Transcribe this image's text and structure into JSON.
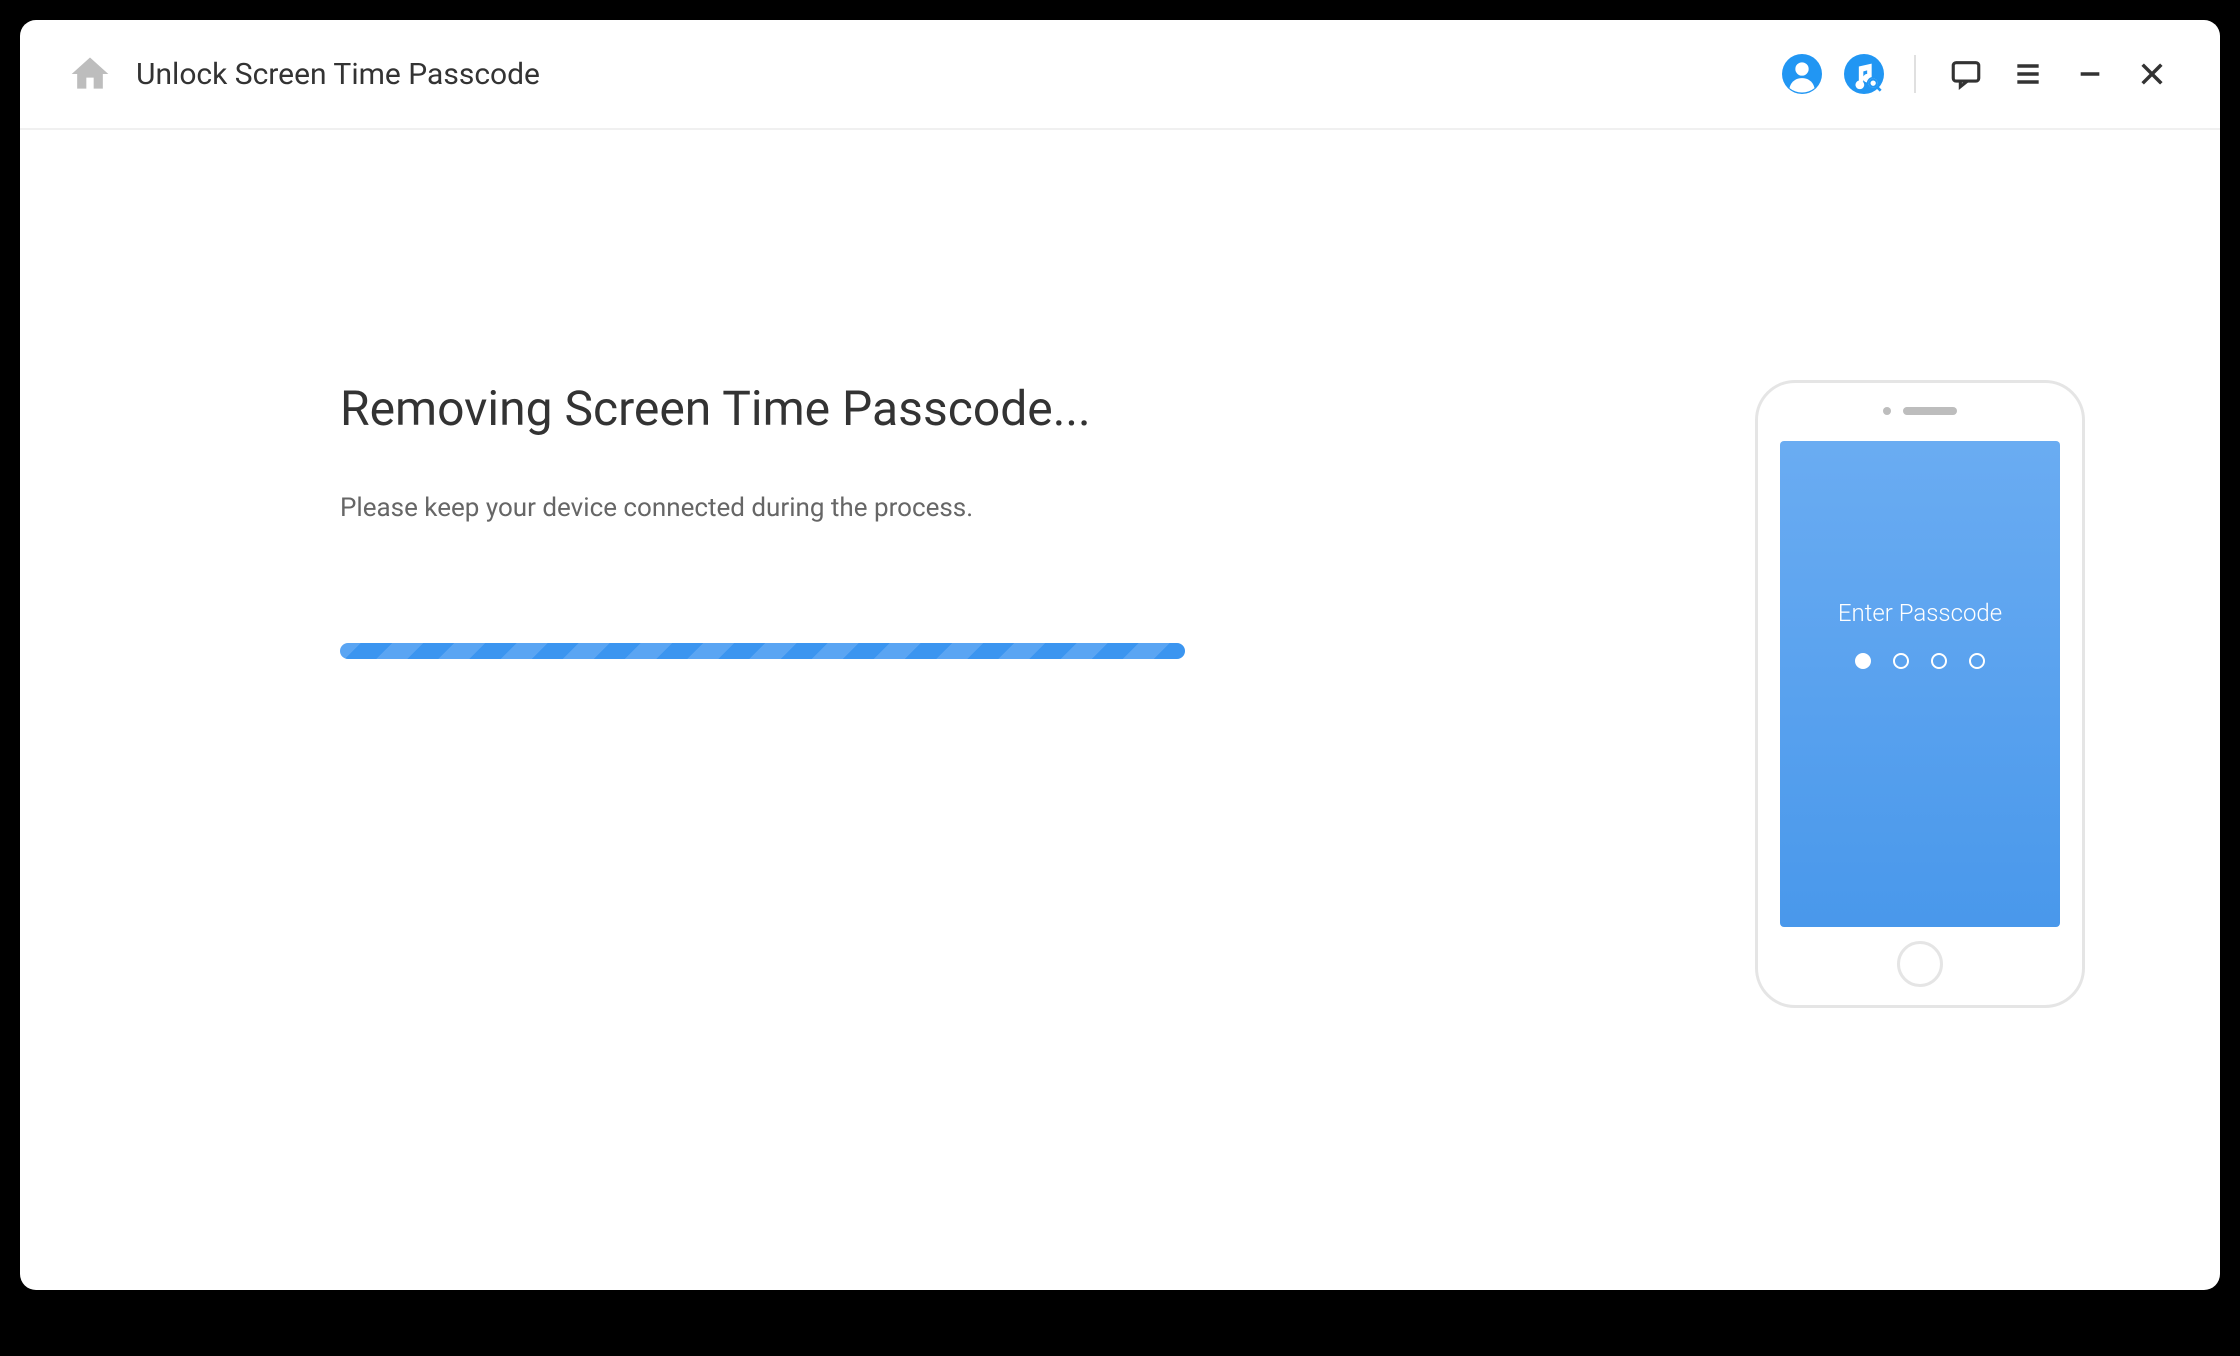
{
  "header": {
    "title": "Unlock Screen Time Passcode"
  },
  "main": {
    "heading": "Removing Screen Time Passcode...",
    "subtitle": "Please keep your device connected during the process."
  },
  "phone": {
    "prompt": "Enter Passcode"
  },
  "icons": {
    "home": "home-icon",
    "account": "account-icon",
    "music": "music-icon",
    "feedback": "feedback-icon",
    "menu": "menu-icon",
    "minimize": "minimize-icon",
    "close": "close-icon"
  },
  "colors": {
    "accent": "#2196f3",
    "progress_a": "#3b95f0",
    "progress_b": "#5aa5f3"
  }
}
